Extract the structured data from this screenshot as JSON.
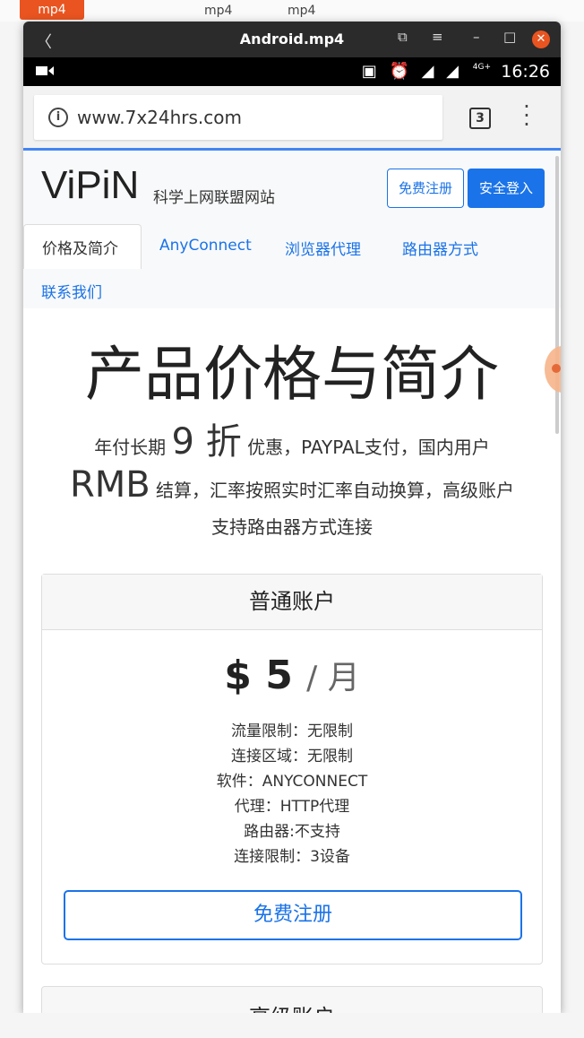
{
  "desktop": {
    "tag": "mp4",
    "labels": [
      "mp4",
      "mp4"
    ]
  },
  "window": {
    "title": "Android.mp4",
    "back_glyph": "〈",
    "controls": [
      "⧉",
      "≡",
      "–",
      "□"
    ],
    "close_glyph": "✕"
  },
  "statusbar": {
    "network": "4G+",
    "time": "16:26"
  },
  "browser": {
    "url": "www.7x24hrs.com",
    "tab_count": "3"
  },
  "site": {
    "brand": "ViPiN",
    "brand_sub": "科学上网联盟网站",
    "register_label": "免费注册",
    "login_label": "安全登入",
    "nav": [
      "价格及简介",
      "AnyConnect",
      "浏览器代理",
      "路由器方式",
      "联系我们"
    ]
  },
  "hero": {
    "title": "产品价格与简介",
    "line1_pre": "年付长期",
    "line1_big": "9 折",
    "line1_post": "优惠，PAYPAL支付，国内用户",
    "line2_big": "RMB",
    "line2_post": "结算，汇率按照实时汇率自动换算，高级账户",
    "line3": "支持路由器方式连接"
  },
  "plan_basic": {
    "name": "普通账户",
    "price": "$ 5",
    "period": "/ 月",
    "features": [
      "流量限制：无限制",
      "连接区域：无限制",
      "软件：ANYCONNECT",
      "代理：HTTP代理",
      "路由器:不支持",
      "连接限制：3设备"
    ],
    "button": "免费注册"
  },
  "plan_premium": {
    "name": "高级账户"
  }
}
